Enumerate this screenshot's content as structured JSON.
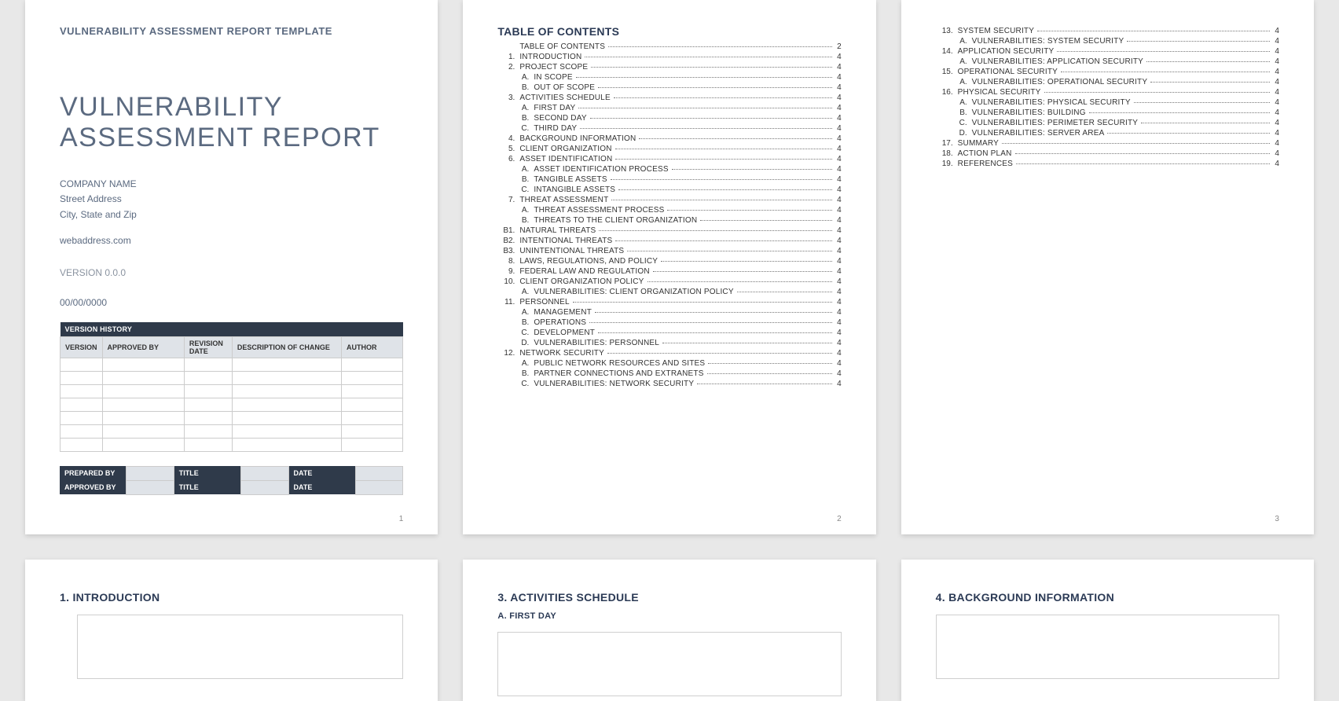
{
  "template_label": "VULNERABILITY ASSESSMENT REPORT TEMPLATE",
  "title": "VULNERABILITY\nASSESSMENT REPORT",
  "company": {
    "name": "COMPANY NAME",
    "street": "Street Address",
    "csz": "City, State and Zip",
    "web": "webaddress.com"
  },
  "version_label": "VERSION 0.0.0",
  "date_label": "00/00/0000",
  "version_history": {
    "title": "VERSION HISTORY",
    "cols": [
      "VERSION",
      "APPROVED BY",
      "REVISION DATE",
      "DESCRIPTION OF CHANGE",
      "AUTHOR"
    ],
    "blank_rows": 7
  },
  "sig": {
    "prepared": "PREPARED BY",
    "title": "TITLE",
    "date": "DATE",
    "approved": "APPROVED BY"
  },
  "page_numbers": {
    "p1": "1",
    "p2": "2",
    "p3": "3"
  },
  "toc_title": "TABLE OF CONTENTS",
  "toc_page2": [
    {
      "n": "",
      "t": "TABLE OF CONTENTS",
      "p": "2",
      "ind": 0
    },
    {
      "n": "1.",
      "t": "INTRODUCTION",
      "p": "4",
      "ind": 0
    },
    {
      "n": "2.",
      "t": "PROJECT SCOPE",
      "p": "4",
      "ind": 0
    },
    {
      "n": "A.",
      "t": "IN SCOPE",
      "p": "4",
      "ind": 1
    },
    {
      "n": "B.",
      "t": "OUT OF SCOPE",
      "p": "4",
      "ind": 1
    },
    {
      "n": "3.",
      "t": "ACTIVITIES SCHEDULE",
      "p": "4",
      "ind": 0
    },
    {
      "n": "A.",
      "t": "FIRST DAY",
      "p": "4",
      "ind": 1
    },
    {
      "n": "B.",
      "t": "SECOND DAY",
      "p": "4",
      "ind": 1
    },
    {
      "n": "C.",
      "t": "THIRD DAY",
      "p": "4",
      "ind": 1
    },
    {
      "n": "4.",
      "t": "BACKGROUND INFORMATION",
      "p": "4",
      "ind": 0
    },
    {
      "n": "5.",
      "t": "CLIENT ORGANIZATION",
      "p": "4",
      "ind": 0
    },
    {
      "n": "6.",
      "t": "ASSET IDENTIFICATION",
      "p": "4",
      "ind": 0
    },
    {
      "n": "A.",
      "t": "ASSET IDENTIFICATION PROCESS",
      "p": "4",
      "ind": 1
    },
    {
      "n": "B.",
      "t": "TANGIBLE ASSETS",
      "p": "4",
      "ind": 1
    },
    {
      "n": "C.",
      "t": "INTANGIBLE ASSETS",
      "p": "4",
      "ind": 1
    },
    {
      "n": "7.",
      "t": "THREAT ASSESSMENT",
      "p": "4",
      "ind": 0
    },
    {
      "n": "A.",
      "t": "THREAT ASSESSMENT PROCESS",
      "p": "4",
      "ind": 1
    },
    {
      "n": "B.",
      "t": "THREATS TO THE CLIENT ORGANIZATION",
      "p": "4",
      "ind": 1
    },
    {
      "n": "B1.",
      "t": "NATURAL THREATS",
      "p": "4",
      "ind": 0
    },
    {
      "n": "B2.",
      "t": "INTENTIONAL THREATS",
      "p": "4",
      "ind": 0
    },
    {
      "n": "B3.",
      "t": "UNINTENTIONAL THREATS",
      "p": "4",
      "ind": 0
    },
    {
      "n": "8.",
      "t": "LAWS, REGULATIONS, AND POLICY",
      "p": "4",
      "ind": 0
    },
    {
      "n": "9.",
      "t": "FEDERAL LAW AND REGULATION",
      "p": "4",
      "ind": 0
    },
    {
      "n": "10.",
      "t": "CLIENT ORGANIZATION POLICY",
      "p": "4",
      "ind": 0
    },
    {
      "n": "A.",
      "t": "VULNERABILITIES: CLIENT ORGANIZATION POLICY",
      "p": "4",
      "ind": 1
    },
    {
      "n": "11.",
      "t": "PERSONNEL",
      "p": "4",
      "ind": 0
    },
    {
      "n": "A.",
      "t": "MANAGEMENT",
      "p": "4",
      "ind": 1
    },
    {
      "n": "B.",
      "t": "OPERATIONS",
      "p": "4",
      "ind": 1
    },
    {
      "n": "C.",
      "t": "DEVELOPMENT",
      "p": "4",
      "ind": 1
    },
    {
      "n": "D.",
      "t": "VULNERABILITIES: PERSONNEL",
      "p": "4",
      "ind": 1
    },
    {
      "n": "12.",
      "t": "NETWORK SECURITY",
      "p": "4",
      "ind": 0
    },
    {
      "n": "A.",
      "t": "PUBLIC NETWORK RESOURCES AND SITES",
      "p": "4",
      "ind": 1
    },
    {
      "n": "B.",
      "t": "PARTNER CONNECTIONS AND EXTRANETS",
      "p": "4",
      "ind": 1
    },
    {
      "n": "C.",
      "t": "VULNERABILITIES: NETWORK SECURITY",
      "p": "4",
      "ind": 1
    }
  ],
  "toc_page3": [
    {
      "n": "13.",
      "t": "SYSTEM SECURITY",
      "p": "4",
      "ind": 0
    },
    {
      "n": "A.",
      "t": "VULNERABILITIES: SYSTEM SECURITY",
      "p": "4",
      "ind": 1
    },
    {
      "n": "14.",
      "t": "APPLICATION SECURITY",
      "p": "4",
      "ind": 0
    },
    {
      "n": "A.",
      "t": "VULNERABILITIES: APPLICATION SECURITY",
      "p": "4",
      "ind": 1
    },
    {
      "n": "15.",
      "t": "OPERATIONAL SECURITY",
      "p": "4",
      "ind": 0
    },
    {
      "n": "A.",
      "t": "VULNERABILITIES: OPERATIONAL SECURITY",
      "p": "4",
      "ind": 1
    },
    {
      "n": "16.",
      "t": "PHYSICAL SECURITY",
      "p": "4",
      "ind": 0
    },
    {
      "n": "A.",
      "t": "VULNERABILITIES: PHYSICAL SECURITY",
      "p": "4",
      "ind": 1
    },
    {
      "n": "B.",
      "t": "VULNERABILITIES: BUILDING",
      "p": "4",
      "ind": 1
    },
    {
      "n": "C.",
      "t": "VULNERABILITIES: PERIMETER SECURITY",
      "p": "4",
      "ind": 1
    },
    {
      "n": "D.",
      "t": "VULNERABILITIES: SERVER AREA",
      "p": "4",
      "ind": 1
    },
    {
      "n": "17.",
      "t": "SUMMARY",
      "p": "4",
      "ind": 0
    },
    {
      "n": "18.",
      "t": "ACTION PLAN",
      "p": "4",
      "ind": 0
    },
    {
      "n": "19.",
      "t": "REFERENCES",
      "p": "4",
      "ind": 0
    }
  ],
  "sections": {
    "p4_h": "1.  INTRODUCTION",
    "p5_h": "3.  ACTIVITIES SCHEDULE",
    "p5_sub": "A.  FIRST DAY",
    "p6_h": "4.  BACKGROUND INFORMATION"
  }
}
